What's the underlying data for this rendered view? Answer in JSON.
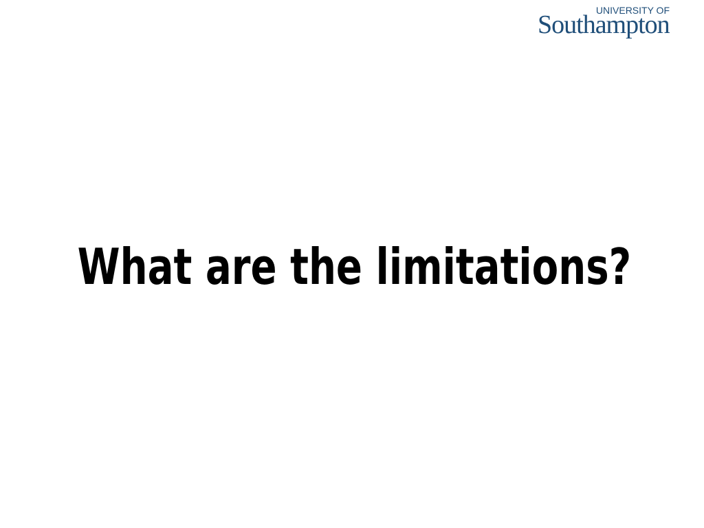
{
  "slide": {
    "title": "What are the limitations?"
  },
  "logo": {
    "line1": "UNIVERSITY OF",
    "line2": "Southampton",
    "color": "#1f4e79"
  }
}
